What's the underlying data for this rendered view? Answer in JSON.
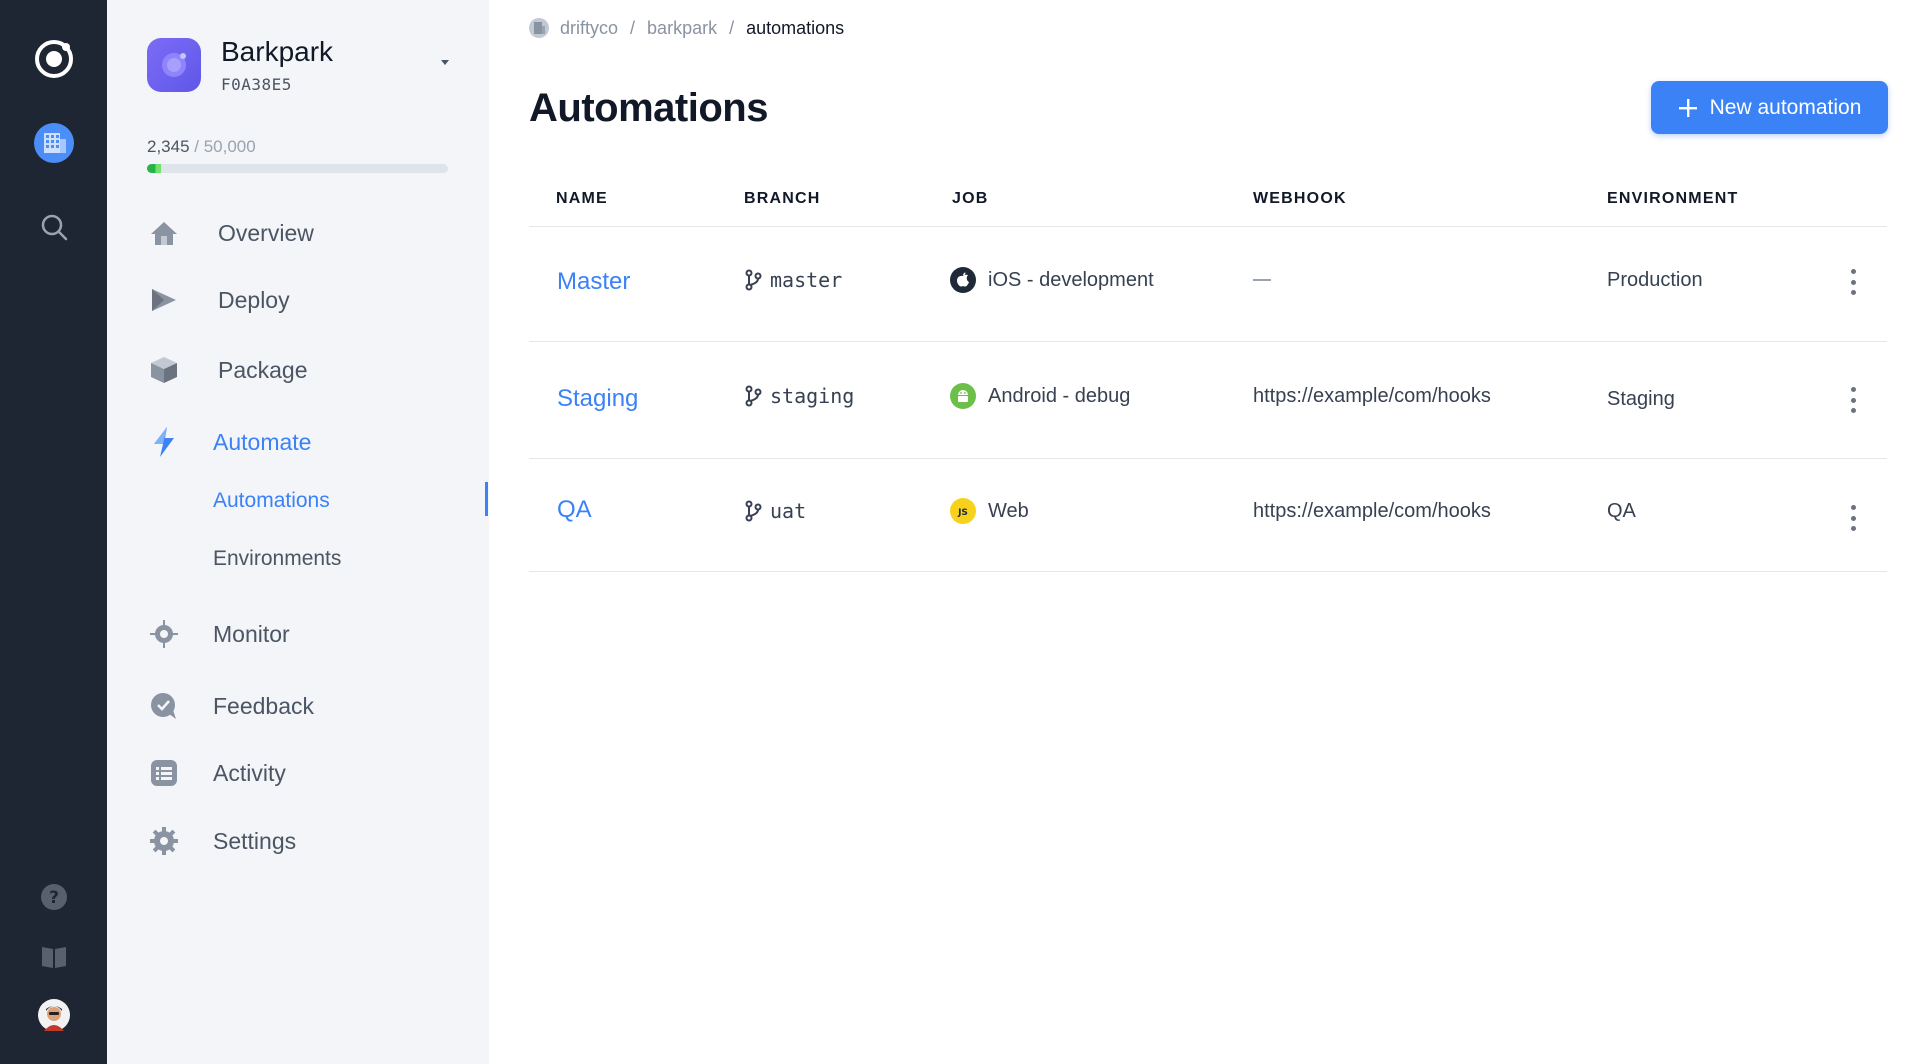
{
  "rail": {
    "icons": [
      "ionic-logo-icon",
      "organization-icon",
      "search-icon",
      "help-icon",
      "docs-book-icon",
      "user-avatar-icon"
    ]
  },
  "app": {
    "name": "Barkpark",
    "id": "F0A38E5"
  },
  "usage": {
    "current": "2,345",
    "separator": " / ",
    "max": "50,000",
    "fraction": 0.047
  },
  "nav": {
    "overview": "Overview",
    "deploy": "Deploy",
    "package": "Package",
    "automate": "Automate",
    "automations": "Automations",
    "environments": "Environments",
    "monitor": "Monitor",
    "feedback": "Feedback",
    "activity": "Activity",
    "settings": "Settings"
  },
  "breadcrumb": {
    "org": "driftyco",
    "sep": "/",
    "app": "barkpark",
    "page": "automations"
  },
  "page": {
    "title": "Automations",
    "new_button": "New automation"
  },
  "table": {
    "headers": {
      "name": "NAME",
      "branch": "BRANCH",
      "job": "JOB",
      "webhook": "WEBHOOK",
      "environment": "ENVIRONMENT"
    },
    "rows": [
      {
        "name": "Master",
        "branch": "master",
        "job": "iOS - development",
        "job_platform": "apple-icon",
        "webhook": "",
        "environment": "Production"
      },
      {
        "name": "Staging",
        "branch": "staging",
        "job": "Android - debug",
        "job_platform": "android-icon",
        "webhook": "https://example/com/hooks",
        "environment": "Staging"
      },
      {
        "name": "QA",
        "branch": "uat",
        "job": "Web",
        "job_platform": "javascript-icon",
        "webhook": "https://example/com/hooks",
        "environment": "QA"
      }
    ]
  },
  "colors": {
    "accent": "#3b82f6",
    "rail": "#1f2633",
    "sidebar": "#f3f5f8",
    "usage_green": "#28b34a",
    "android": "#6cc04a",
    "js": "#f7d21c"
  }
}
